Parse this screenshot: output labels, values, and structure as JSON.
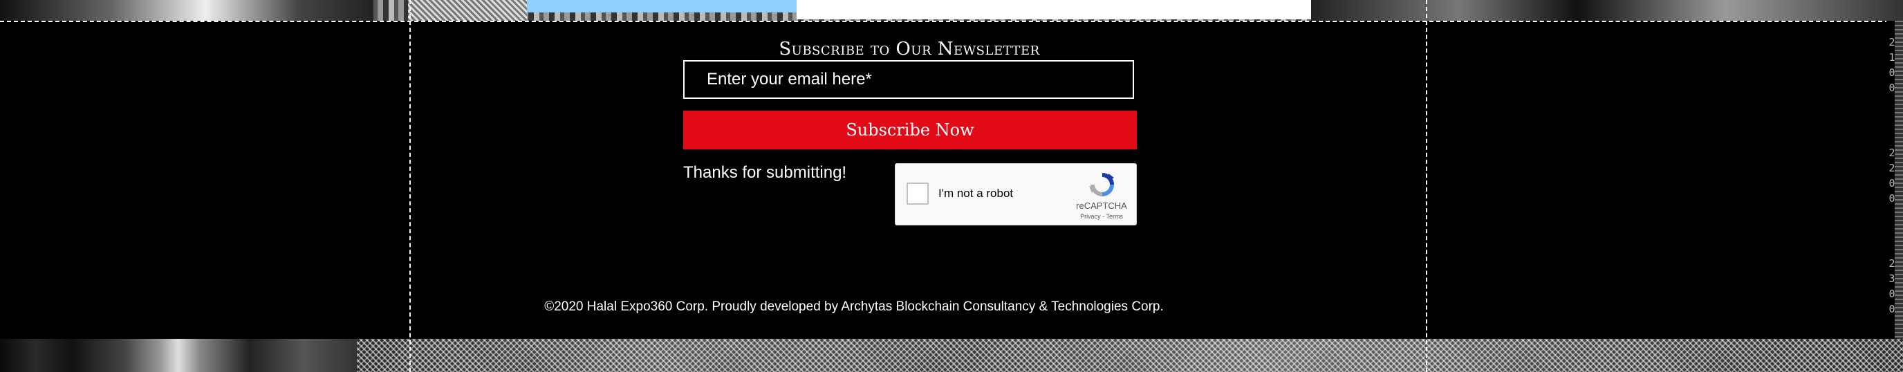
{
  "newsletter": {
    "title": "Subscribe to Our Newsletter",
    "email_placeholder": "Enter your email here*",
    "email_value": "",
    "subscribe_label": "Subscribe Now",
    "thanks_message": "Thanks for submitting!"
  },
  "recaptcha": {
    "checkbox_label": "I'm not a robot",
    "brand": "reCAPTCHA",
    "privacy_link": "Privacy",
    "separator": "-",
    "terms_link": "Terms"
  },
  "ruler": {
    "labels": [
      "2100",
      "2200",
      "2300"
    ]
  },
  "footer": {
    "copyright": "©2020 Halal Expo360 Corp. Proudly developed by Archytas Blockchain Consultancy & Technologies Corp."
  },
  "colors": {
    "background": "#000000",
    "accent": "#e30a17",
    "text": "#ffffff"
  },
  "icons": [
    "recaptcha-logo-icon",
    "checkbox-icon"
  ]
}
